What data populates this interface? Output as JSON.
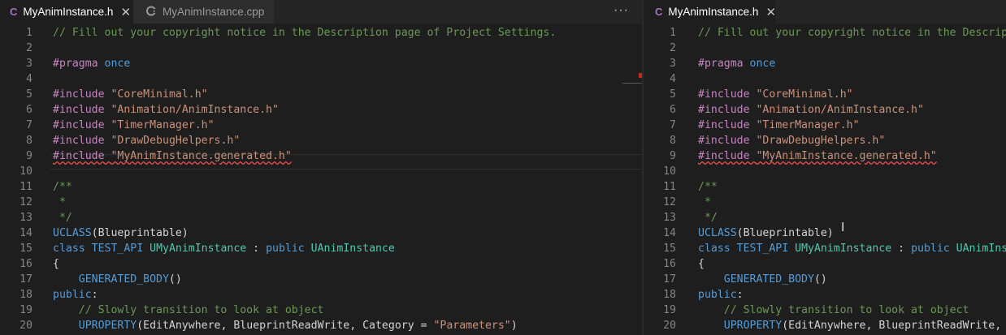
{
  "editor": {
    "left": {
      "tabs": [
        {
          "label": "MyAnimInstance.h",
          "icon": "C",
          "close": "✕",
          "active": true
        },
        {
          "label": "MyAnimInstance.cpp",
          "icon": "C",
          "active": false
        }
      ],
      "more_actions": "···"
    },
    "right": {
      "tabs": [
        {
          "label": "MyAnimInstance.h",
          "icon": "C",
          "close": "✕",
          "active": true
        }
      ]
    },
    "lines": [
      {
        "n": "1",
        "parts": [
          {
            "t": "// Fill out your copyright notice in the Description page of Project Settings.",
            "c": "cm"
          }
        ]
      },
      {
        "n": "2",
        "parts": []
      },
      {
        "n": "3",
        "parts": [
          {
            "t": "#pragma",
            "c": "pp"
          },
          {
            "t": " ",
            "c": "tx"
          },
          {
            "t": "once",
            "c": "kw"
          }
        ]
      },
      {
        "n": "4",
        "parts": []
      },
      {
        "n": "5",
        "parts": [
          {
            "t": "#include",
            "c": "pp"
          },
          {
            "t": " ",
            "c": "tx"
          },
          {
            "t": "\"CoreMinimal.h\"",
            "c": "st"
          }
        ]
      },
      {
        "n": "6",
        "parts": [
          {
            "t": "#include",
            "c": "pp"
          },
          {
            "t": " ",
            "c": "tx"
          },
          {
            "t": "\"Animation/AnimInstance.h\"",
            "c": "st"
          }
        ]
      },
      {
        "n": "7",
        "parts": [
          {
            "t": "#include",
            "c": "pp"
          },
          {
            "t": " ",
            "c": "tx"
          },
          {
            "t": "\"TimerManager.h\"",
            "c": "st"
          }
        ]
      },
      {
        "n": "8",
        "parts": [
          {
            "t": "#include",
            "c": "pp"
          },
          {
            "t": " ",
            "c": "tx"
          },
          {
            "t": "\"DrawDebugHelpers.h\"",
            "c": "st"
          }
        ]
      },
      {
        "n": "9",
        "parts": [
          {
            "t": "#include \"MyAnimInstance.generated.h\"",
            "c": "pp err",
            "split": true
          }
        ]
      },
      {
        "n": "10",
        "parts": []
      },
      {
        "n": "11",
        "parts": [
          {
            "t": "/**",
            "c": "cm"
          }
        ]
      },
      {
        "n": "12",
        "parts": [
          {
            "t": " *",
            "c": "cm"
          }
        ]
      },
      {
        "n": "13",
        "parts": [
          {
            "t": " */",
            "c": "cm"
          }
        ]
      },
      {
        "n": "14",
        "parts": [
          {
            "t": "UCLASS",
            "c": "kw"
          },
          {
            "t": "(Blueprintable)",
            "c": "tx"
          }
        ]
      },
      {
        "n": "15",
        "parts": [
          {
            "t": "class",
            "c": "kw"
          },
          {
            "t": " ",
            "c": "tx"
          },
          {
            "t": "TEST_API",
            "c": "kw"
          },
          {
            "t": " ",
            "c": "tx"
          },
          {
            "t": "UMyAnimInstance",
            "c": "ty"
          },
          {
            "t": " : ",
            "c": "tx"
          },
          {
            "t": "public",
            "c": "kw"
          },
          {
            "t": " ",
            "c": "tx"
          },
          {
            "t": "UAnimInstance",
            "c": "ty"
          }
        ]
      },
      {
        "n": "16",
        "parts": [
          {
            "t": "{",
            "c": "tx"
          }
        ]
      },
      {
        "n": "17",
        "parts": [
          {
            "t": "    ",
            "c": "tx"
          },
          {
            "t": "GENERATED_BODY",
            "c": "kw"
          },
          {
            "t": "()",
            "c": "tx"
          }
        ]
      },
      {
        "n": "18",
        "parts": [
          {
            "t": "public",
            "c": "kw"
          },
          {
            "t": ":",
            "c": "tx"
          }
        ]
      },
      {
        "n": "19",
        "parts": [
          {
            "t": "    // Slowly transition to look at object",
            "c": "cm"
          }
        ]
      },
      {
        "n": "20",
        "parts": [
          {
            "t": "    ",
            "c": "tx"
          },
          {
            "t": "UPROPERTY",
            "c": "kw"
          },
          {
            "t": "(EditAnywhere, BlueprintReadWrite, Category = ",
            "c": "tx"
          },
          {
            "t": "\"Parameters\"",
            "c": "st"
          },
          {
            "t": ")",
            "c": "tx"
          }
        ]
      }
    ]
  },
  "colors": {
    "background": "#1e1e1e",
    "comment": "#6a9955",
    "keyword": "#569cd6",
    "preprocessor": "#c586c0",
    "string": "#ce9178",
    "type": "#4ec9b0",
    "error_squiggle": "#f14c4c"
  }
}
